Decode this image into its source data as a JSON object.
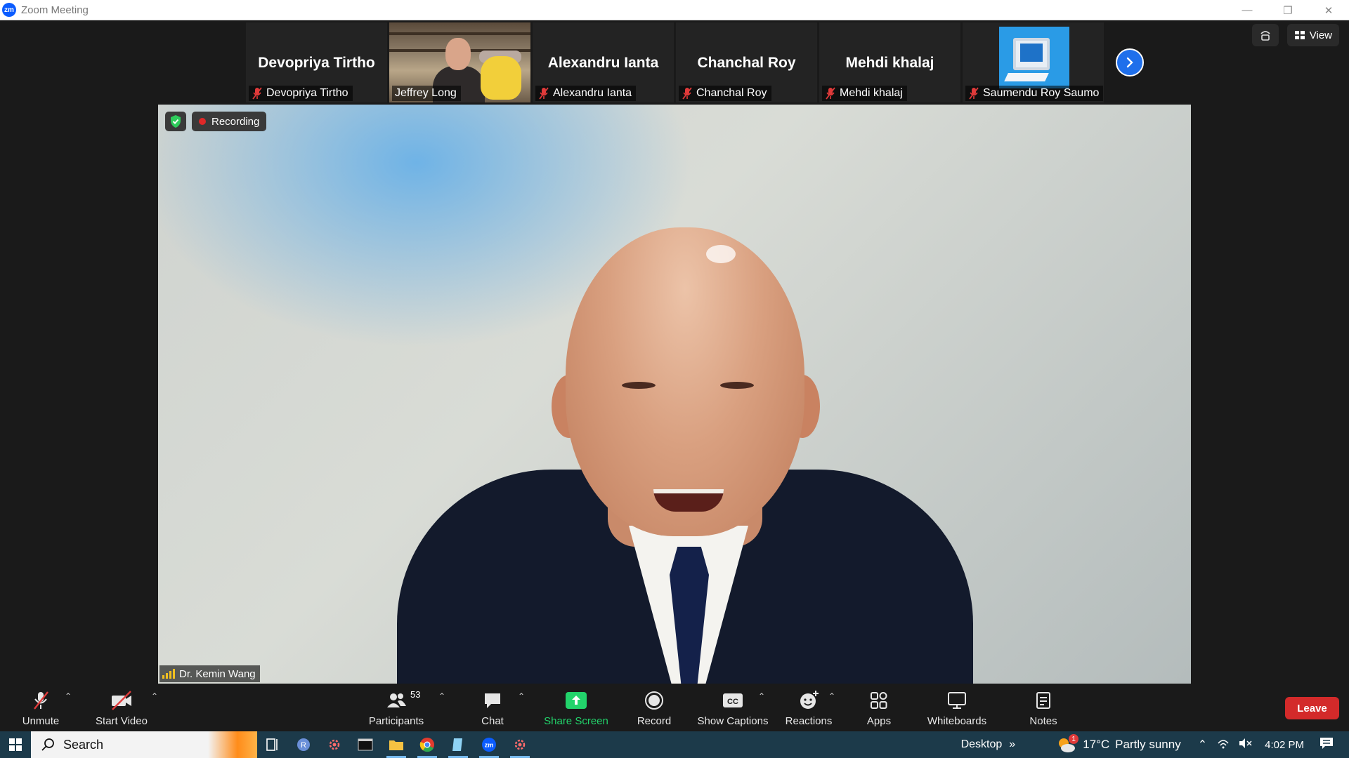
{
  "window": {
    "app_icon_text": "zm",
    "title": "Zoom Meeting"
  },
  "thumbnails": [
    {
      "big_name": "Devopriya Tirtho",
      "label": "Devopriya Tirtho",
      "muted": true,
      "kind": "name"
    },
    {
      "big_name": "",
      "label": "Jeffrey Long",
      "muted": false,
      "kind": "video"
    },
    {
      "big_name": "Alexandru Ianta",
      "label": "Alexandru Ianta",
      "muted": true,
      "kind": "name"
    },
    {
      "big_name": "Chanchal Roy",
      "label": "Chanchal Roy",
      "muted": true,
      "kind": "name"
    },
    {
      "big_name": "Mehdi khalaj",
      "label": "Mehdi khalaj",
      "muted": true,
      "kind": "name"
    },
    {
      "big_name": "",
      "label": "Saumendu Roy Saumo",
      "muted": true,
      "kind": "image"
    }
  ],
  "top_right": {
    "view_label": "View"
  },
  "main_video": {
    "recording_label": "Recording",
    "speaker_name": "Dr. Kemin Wang"
  },
  "toolbar": {
    "unmute": "Unmute",
    "start_video": "Start Video",
    "participants": "Participants",
    "participants_count": "53",
    "chat": "Chat",
    "share_screen": "Share Screen",
    "record": "Record",
    "show_captions": "Show Captions",
    "reactions": "Reactions",
    "apps": "Apps",
    "whiteboards": "Whiteboards",
    "notes": "Notes",
    "leave": "Leave"
  },
  "taskbar": {
    "search_placeholder": "Search",
    "desktop_label": "Desktop",
    "weather_temp": "17°C",
    "weather_desc": "Partly sunny",
    "weather_badge": "1",
    "time": "4:02 PM"
  },
  "colors": {
    "accent_blue": "#0b5cff",
    "share_green": "#22d36b",
    "leave_red": "#d32a2a",
    "recording_red": "#e02828"
  }
}
